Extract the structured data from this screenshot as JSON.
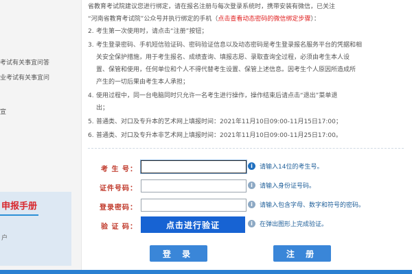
{
  "left_panel": {
    "snippets": [
      "考试有关事宜问答",
      "业考试有关事宜问",
      "宣"
    ],
    "guide_title": "申报手册",
    "guide_snip": "户"
  },
  "notice": {
    "line0a": "省教育考试院建议您进行绑定，请在报名注册与每次登录系统时，携带安装有微信，已关注",
    "line0b": "“河南省教育考试院”公众号并执行绑定的手机（",
    "line0b_red": "点击查看动态密码的微信绑定步骤",
    "line0b_end": "）：",
    "item2": "考生第一次使用时，请点击“注册”按钮；",
    "item3a": "考生登录密码、手机短信验证码、密码验证信息以及动态密码是考生登录报名服务平台的凭据和相",
    "item3b": "关安全保护措施，用于考生报名、成绩查询、填报志愿、录取查询全过程，必须由考生本人设",
    "item3c": "置、保管和使用，任何单位和个人不得代替考生设置、保管上述信息。因考生个人原因所造成所",
    "item3d": "产生的一切后果由考生本人承担；",
    "item4a": "使用过程中，同一台电脑同时只允许一名考生进行操作，操作结束后请点击“退出”菜单退",
    "item4b": "出；",
    "item5": "普通类、对口及专升本的艺术网上填报时间：2021年11月10日09:00-11月15日17:00；",
    "item6": "普通类、对口及专升本非艺术网上填报时间：2021年11月10日09:00-11月25日17:00。",
    "numbers": [
      "2.",
      "3.",
      "4.",
      "5.",
      "6."
    ]
  },
  "form": {
    "exam_no": {
      "label": "考 生 号：",
      "value": "",
      "hint": "请输入14位的考生号。"
    },
    "id_no": {
      "label": "证件号码：",
      "value": "",
      "hint": "请输入身份证号码。"
    },
    "password": {
      "label": "登录密码：",
      "value": "",
      "hint": "请输入包含字母、数字和符号的密码。"
    },
    "captcha": {
      "label": "验 证 码：",
      "button": "点击进行验证",
      "hint": "在弹出图形上完成验证。"
    }
  },
  "buttons": {
    "login": "登 录",
    "register": "注 册"
  },
  "icons": {
    "info": "i"
  },
  "colors": {
    "accent": "#1763d3",
    "label": "#c0392b",
    "hint": "#1f5f99",
    "notice_red": "#e02020"
  }
}
